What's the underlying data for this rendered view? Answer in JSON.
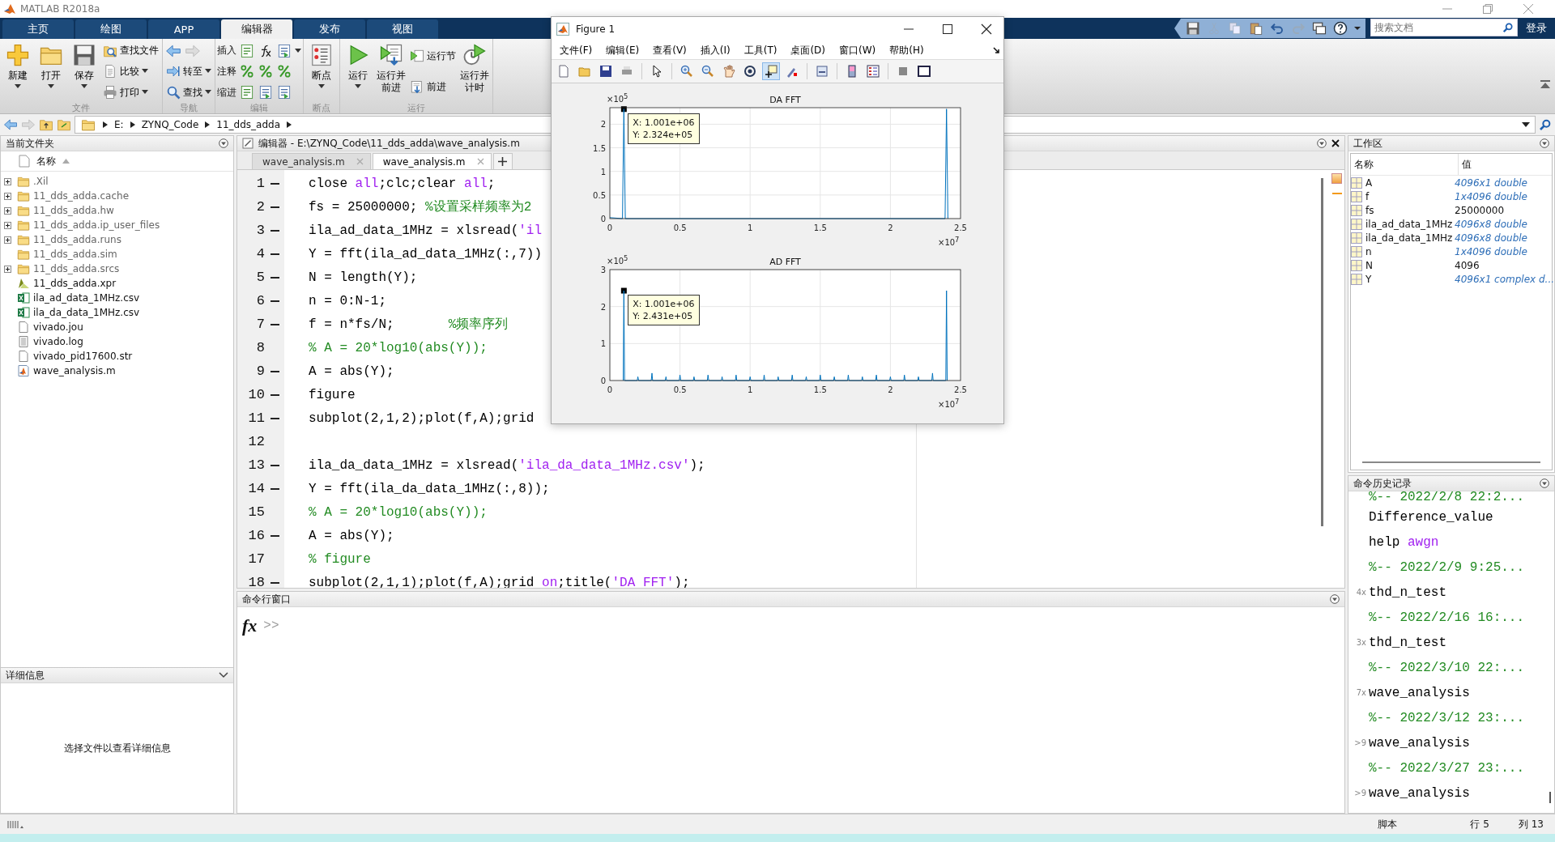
{
  "app_title": "MATLAB R2018a",
  "tabs": [
    {
      "label": "主页",
      "selected": false
    },
    {
      "label": "绘图",
      "selected": false
    },
    {
      "label": "APP",
      "selected": false
    },
    {
      "label": "编辑器",
      "selected": true
    },
    {
      "label": "发布",
      "selected": false
    },
    {
      "label": "视图",
      "selected": false
    }
  ],
  "search": {
    "placeholder": "搜索文档"
  },
  "sign_in": "登录",
  "ribbon": {
    "groups": [
      {
        "label": "文件",
        "buttons": [
          {
            "kind": "large",
            "label": "新建",
            "dropdown": true
          },
          {
            "kind": "large",
            "label": "打开",
            "dropdown": true
          },
          {
            "kind": "large",
            "label": "保存",
            "dropdown": true
          },
          {
            "kind": "small",
            "label": "查找文件",
            "dropdown": false
          },
          {
            "kind": "small",
            "label": "比较",
            "dropdown": true
          },
          {
            "kind": "small",
            "label": "打印",
            "dropdown": true
          }
        ]
      },
      {
        "label": "导航",
        "buttons": [
          {
            "kind": "nav_arrows"
          },
          {
            "kind": "small",
            "label": "转至",
            "dropdown": true
          },
          {
            "kind": "small",
            "label": "查找",
            "dropdown": true
          }
        ]
      },
      {
        "label": "编辑",
        "buttons": [
          {
            "kind": "tool_row",
            "label": "插入",
            "dropdown": true
          },
          {
            "kind": "tool_row",
            "label": "注释",
            "dropdown": false
          },
          {
            "kind": "tool_row",
            "label": "缩进",
            "dropdown": false
          }
        ]
      },
      {
        "label": "断点",
        "buttons": [
          {
            "kind": "large",
            "label": "断点",
            "dropdown": true
          }
        ]
      },
      {
        "label": "运行",
        "buttons": [
          {
            "kind": "large",
            "label": "运行",
            "dropdown": true
          },
          {
            "kind": "large",
            "label": "运行并前进",
            "dropdown": false
          },
          {
            "kind": "small",
            "label": "运行节",
            "dropdown": false
          },
          {
            "kind": "small",
            "label": "前进",
            "dropdown": false
          },
          {
            "kind": "large",
            "label": "运行并计时",
            "dropdown": false
          }
        ]
      }
    ]
  },
  "address": {
    "path": [
      "E:",
      "ZYNQ_Code",
      "11_dds_adda"
    ]
  },
  "current_folder": {
    "title": "当前文件夹",
    "column": "名称",
    "items": [
      {
        "name": ".Xil",
        "kind": "folder",
        "expandable": true
      },
      {
        "name": "11_dds_adda.cache",
        "kind": "folder",
        "expandable": true
      },
      {
        "name": "11_dds_adda.hw",
        "kind": "folder",
        "expandable": true
      },
      {
        "name": "11_dds_adda.ip_user_files",
        "kind": "folder",
        "expandable": true
      },
      {
        "name": "11_dds_adda.runs",
        "kind": "folder",
        "expandable": true
      },
      {
        "name": "11_dds_adda.sim",
        "kind": "folder",
        "expandable": false
      },
      {
        "name": "11_dds_adda.srcs",
        "kind": "folder",
        "expandable": true
      },
      {
        "name": "11_dds_adda.xpr",
        "kind": "project"
      },
      {
        "name": "ila_ad_data_1MHz.csv",
        "kind": "spreadsheet"
      },
      {
        "name": "ila_da_data_1MHz.csv",
        "kind": "spreadsheet"
      },
      {
        "name": "vivado.jou",
        "kind": "file"
      },
      {
        "name": "vivado.log",
        "kind": "text"
      },
      {
        "name": "vivado_pid17600.str",
        "kind": "file"
      },
      {
        "name": "wave_analysis.m",
        "kind": "script"
      }
    ]
  },
  "details": {
    "title": "详细信息",
    "message": "选择文件以查看详细信息"
  },
  "editor": {
    "title": "编辑器 - E:\\ZYNQ_Code\\11_dds_adda\\wave_analysis.m",
    "tabs": [
      {
        "label": "wave_analysis.m",
        "selected": false
      },
      {
        "label": "wave_analysis.m",
        "selected": true
      }
    ],
    "lines": [
      {
        "number": "1",
        "runnable": true,
        "segments": [
          {
            "kind": "code",
            "text": "close "
          },
          {
            "kind": "string",
            "text": "all"
          },
          {
            "kind": "code",
            "text": ";clc;clear "
          },
          {
            "kind": "string",
            "text": "all"
          },
          {
            "kind": "code",
            "text": ";"
          }
        ]
      },
      {
        "number": "2",
        "runnable": true,
        "segments": [
          {
            "kind": "code",
            "text": "fs = 25000000; "
          },
          {
            "kind": "comment",
            "text": "%设置采样频率为2"
          }
        ]
      },
      {
        "number": "3",
        "runnable": true,
        "segments": [
          {
            "kind": "code",
            "text": "ila_ad_data_1MHz = xlsread("
          },
          {
            "kind": "string",
            "text": "'il"
          }
        ]
      },
      {
        "number": "4",
        "runnable": true,
        "segments": [
          {
            "kind": "code",
            "text": "Y = fft(ila_ad_data_1MHz(:,7))"
          }
        ]
      },
      {
        "number": "5",
        "runnable": true,
        "segments": [
          {
            "kind": "code",
            "text": "N = length(Y);"
          }
        ]
      },
      {
        "number": "6",
        "runnable": true,
        "segments": [
          {
            "kind": "code",
            "text": "n = 0:N-1;"
          }
        ]
      },
      {
        "number": "7",
        "runnable": true,
        "segments": [
          {
            "kind": "code",
            "text": "f = n*fs/N;       "
          },
          {
            "kind": "comment",
            "text": "%频率序列"
          }
        ]
      },
      {
        "number": "8",
        "runnable": false,
        "segments": [
          {
            "kind": "comment",
            "text": "% A = 20*log10(abs(Y));"
          }
        ]
      },
      {
        "number": "9",
        "runnable": true,
        "segments": [
          {
            "kind": "code",
            "text": "A = abs(Y);"
          }
        ]
      },
      {
        "number": "10",
        "runnable": true,
        "segments": [
          {
            "kind": "code",
            "text": "figure"
          }
        ]
      },
      {
        "number": "11",
        "runnable": true,
        "segments": [
          {
            "kind": "code",
            "text": "subplot(2,1,2);plot(f,A);grid"
          }
        ]
      },
      {
        "number": "12",
        "runnable": false
      },
      {
        "number": "13",
        "runnable": true,
        "segments": [
          {
            "kind": "code",
            "text": "ila_da_data_1MHz = xlsread("
          },
          {
            "kind": "string",
            "text": "'ila_da_data_1MHz.csv'"
          },
          {
            "kind": "code",
            "text": ");"
          }
        ]
      },
      {
        "number": "14",
        "runnable": true,
        "segments": [
          {
            "kind": "code",
            "text": "Y = fft(ila_da_data_1MHz(:,8));"
          }
        ]
      },
      {
        "number": "15",
        "runnable": false,
        "segments": [
          {
            "kind": "comment",
            "text": "% A = 20*log10(abs(Y));"
          }
        ]
      },
      {
        "number": "16",
        "runnable": true,
        "segments": [
          {
            "kind": "code",
            "text": "A = abs(Y);"
          }
        ]
      },
      {
        "number": "17",
        "runnable": false,
        "segments": [
          {
            "kind": "comment",
            "text": "% figure"
          }
        ]
      },
      {
        "number": "18",
        "runnable": true,
        "segments": [
          {
            "kind": "code",
            "text": "subplot(2,1,1);plot(f,A);grid "
          },
          {
            "kind": "string",
            "text": "on"
          },
          {
            "kind": "code",
            "text": ";title("
          },
          {
            "kind": "string",
            "text": "'DA FFT'"
          },
          {
            "kind": "code",
            "text": ");"
          }
        ]
      }
    ]
  },
  "command_window": {
    "title": "命令行窗口",
    "function_button": "fx",
    "prompt": ">>"
  },
  "workspace": {
    "title": "工作区",
    "columns": [
      "名称",
      "值"
    ],
    "rows": [
      {
        "name": "A",
        "value": "4096x1 double",
        "kind": "array"
      },
      {
        "name": "f",
        "value": "1x4096 double",
        "kind": "array"
      },
      {
        "name": "fs",
        "value": "25000000",
        "kind": "scalar"
      },
      {
        "name": "ila_ad_data_1MHz",
        "value": "4096x8 double",
        "kind": "array"
      },
      {
        "name": "ila_da_data_1MHz",
        "value": "4096x8 double",
        "kind": "array"
      },
      {
        "name": "n",
        "value": "1x4096 double",
        "kind": "array"
      },
      {
        "name": "N",
        "value": "4096",
        "kind": "scalar"
      },
      {
        "name": "Y",
        "value": "4096x1 complex d...",
        "kind": "array"
      }
    ]
  },
  "history": {
    "title": "命令历史记录",
    "entries": [
      {
        "kind": "session",
        "text": "%-- 2022/2/8 22:2..."
      },
      {
        "kind": "command",
        "text": "Difference_value"
      },
      {
        "kind": "command",
        "text": "help ",
        "argument": "awgn"
      },
      {
        "kind": "session",
        "text": "%-- 2022/2/9 9:25..."
      },
      {
        "kind": "command",
        "count": "4x",
        "text": "thd_n_test"
      },
      {
        "kind": "session",
        "text": "%-- 2022/2/16 16:..."
      },
      {
        "kind": "command",
        "count": "3x",
        "text": "thd_n_test"
      },
      {
        "kind": "session",
        "text": "%-- 2022/3/10 22:..."
      },
      {
        "kind": "command",
        "count": "7x",
        "text": "wave_analysis"
      },
      {
        "kind": "session",
        "text": "%-- 2022/3/12 23:..."
      },
      {
        "kind": "command",
        "count": ">9",
        "text": "wave_analysis"
      },
      {
        "kind": "session",
        "text": "%-- 2022/3/27 23:..."
      },
      {
        "kind": "command",
        "count": ">9",
        "text": "wave_analysis"
      }
    ]
  },
  "status_bar": {
    "mode": "脚本",
    "line": "行 5",
    "column": "列 13"
  },
  "figure": {
    "title": "Figure 1",
    "menus": [
      "文件(F)",
      "编辑(E)",
      "查看(V)",
      "插入(I)",
      "工具(T)",
      "桌面(D)",
      "窗口(W)",
      "帮助(H)"
    ],
    "toolbar": [
      {
        "selected": false
      },
      {
        "selected": false
      },
      {
        "selected": false
      },
      {
        "selected": false
      },
      {
        "selected": false
      },
      {
        "selected": false
      },
      {
        "selected": false
      },
      {
        "selected": false
      },
      {
        "selected": false
      },
      {
        "selected": true
      },
      {
        "selected": false
      },
      {
        "selected": false
      },
      {
        "selected": false
      },
      {
        "selected": false
      },
      {
        "selected": false
      },
      {
        "selected": false
      }
    ],
    "plots": [
      {
        "x_multiplier": "×10$^{7}$",
        "y_multiplier": "×10$^{5}$",
        "chart_data": {
          "type": "line",
          "title": "DA FFT",
          "grid": true,
          "xlim": [
            0,
            2.5
          ],
          "ylim": [
            0,
            2.35
          ],
          "xticks": [
            0,
            0.5,
            1,
            1.5,
            2,
            2.5
          ],
          "yticks": [
            0,
            0.5,
            1,
            1.5,
            2
          ],
          "x": [
            0,
            0.09,
            0.1001,
            0.11,
            2.39,
            2.4,
            2.41
          ],
          "series": [
            {
              "color": "#0072bd",
              "values": [
                0.02,
                0,
                2.32,
                0,
                0,
                2.32,
                0
              ]
            }
          ],
          "annotations": [
            {
              "x": 0.1001,
              "y": 2.32,
              "text": "X: 1.001e+06\nY: 2.324e+05"
            }
          ]
        }
      },
      {
        "x_multiplier": "×10$^{7}$",
        "y_multiplier": "×10$^{5}$",
        "chart_data": {
          "type": "line",
          "title": "AD FFT",
          "grid": true,
          "xlim": [
            0,
            2.5
          ],
          "ylim": [
            0,
            3
          ],
          "xticks": [
            0,
            0.5,
            1,
            1.5,
            2,
            2.5
          ],
          "yticks": [
            0,
            1,
            2,
            3
          ],
          "x": [
            0.095,
            0.1001,
            0.105,
            0.195,
            0.2,
            0.205,
            0.295,
            0.3,
            0.305,
            0.395,
            0.4,
            0.405,
            0.495,
            0.5,
            0.505,
            0.595,
            0.6,
            0.605,
            0.695,
            0.7,
            0.705,
            0.795,
            0.8,
            0.805,
            0.895,
            0.9,
            0.905,
            0.995,
            1,
            1.005,
            1.095,
            1.1,
            1.105,
            1.195,
            1.2,
            1.205,
            1.295,
            1.3,
            1.305,
            1.395,
            1.4,
            1.405,
            1.495,
            1.5,
            1.505,
            1.595,
            1.6,
            1.605,
            1.695,
            1.7,
            1.705,
            1.795,
            1.8,
            1.805,
            1.895,
            1.9,
            1.905,
            1.995,
            2,
            2.005,
            2.095,
            2.1,
            2.105,
            2.195,
            2.2,
            2.205,
            2.295,
            2.3,
            2.305,
            2.395,
            2.4,
            2.405
          ],
          "series": [
            {
              "color": "#0072bd",
              "values": [
                0,
                2.43,
                0,
                0,
                0.1,
                0,
                0,
                0.2,
                0,
                0,
                0.1,
                0,
                0,
                0.15,
                0,
                0,
                0.1,
                0,
                0,
                0.15,
                0,
                0,
                0.1,
                0,
                0,
                0.15,
                0,
                0,
                0.1,
                0,
                0,
                0.15,
                0,
                0,
                0.1,
                0,
                0,
                0.15,
                0,
                0,
                0.1,
                0,
                0,
                0.15,
                0,
                0,
                0.1,
                0,
                0,
                0.15,
                0,
                0,
                0.1,
                0,
                0,
                0.15,
                0,
                0,
                0.1,
                0,
                0,
                0.15,
                0,
                0,
                0.1,
                0,
                0,
                0.2,
                0,
                0,
                2.43,
                0
              ]
            }
          ],
          "annotations": [
            {
              "x": 0.1001,
              "y": 2.43,
              "text": "X: 1.001e+06\nY: 2.431e+05"
            }
          ]
        }
      }
    ]
  }
}
